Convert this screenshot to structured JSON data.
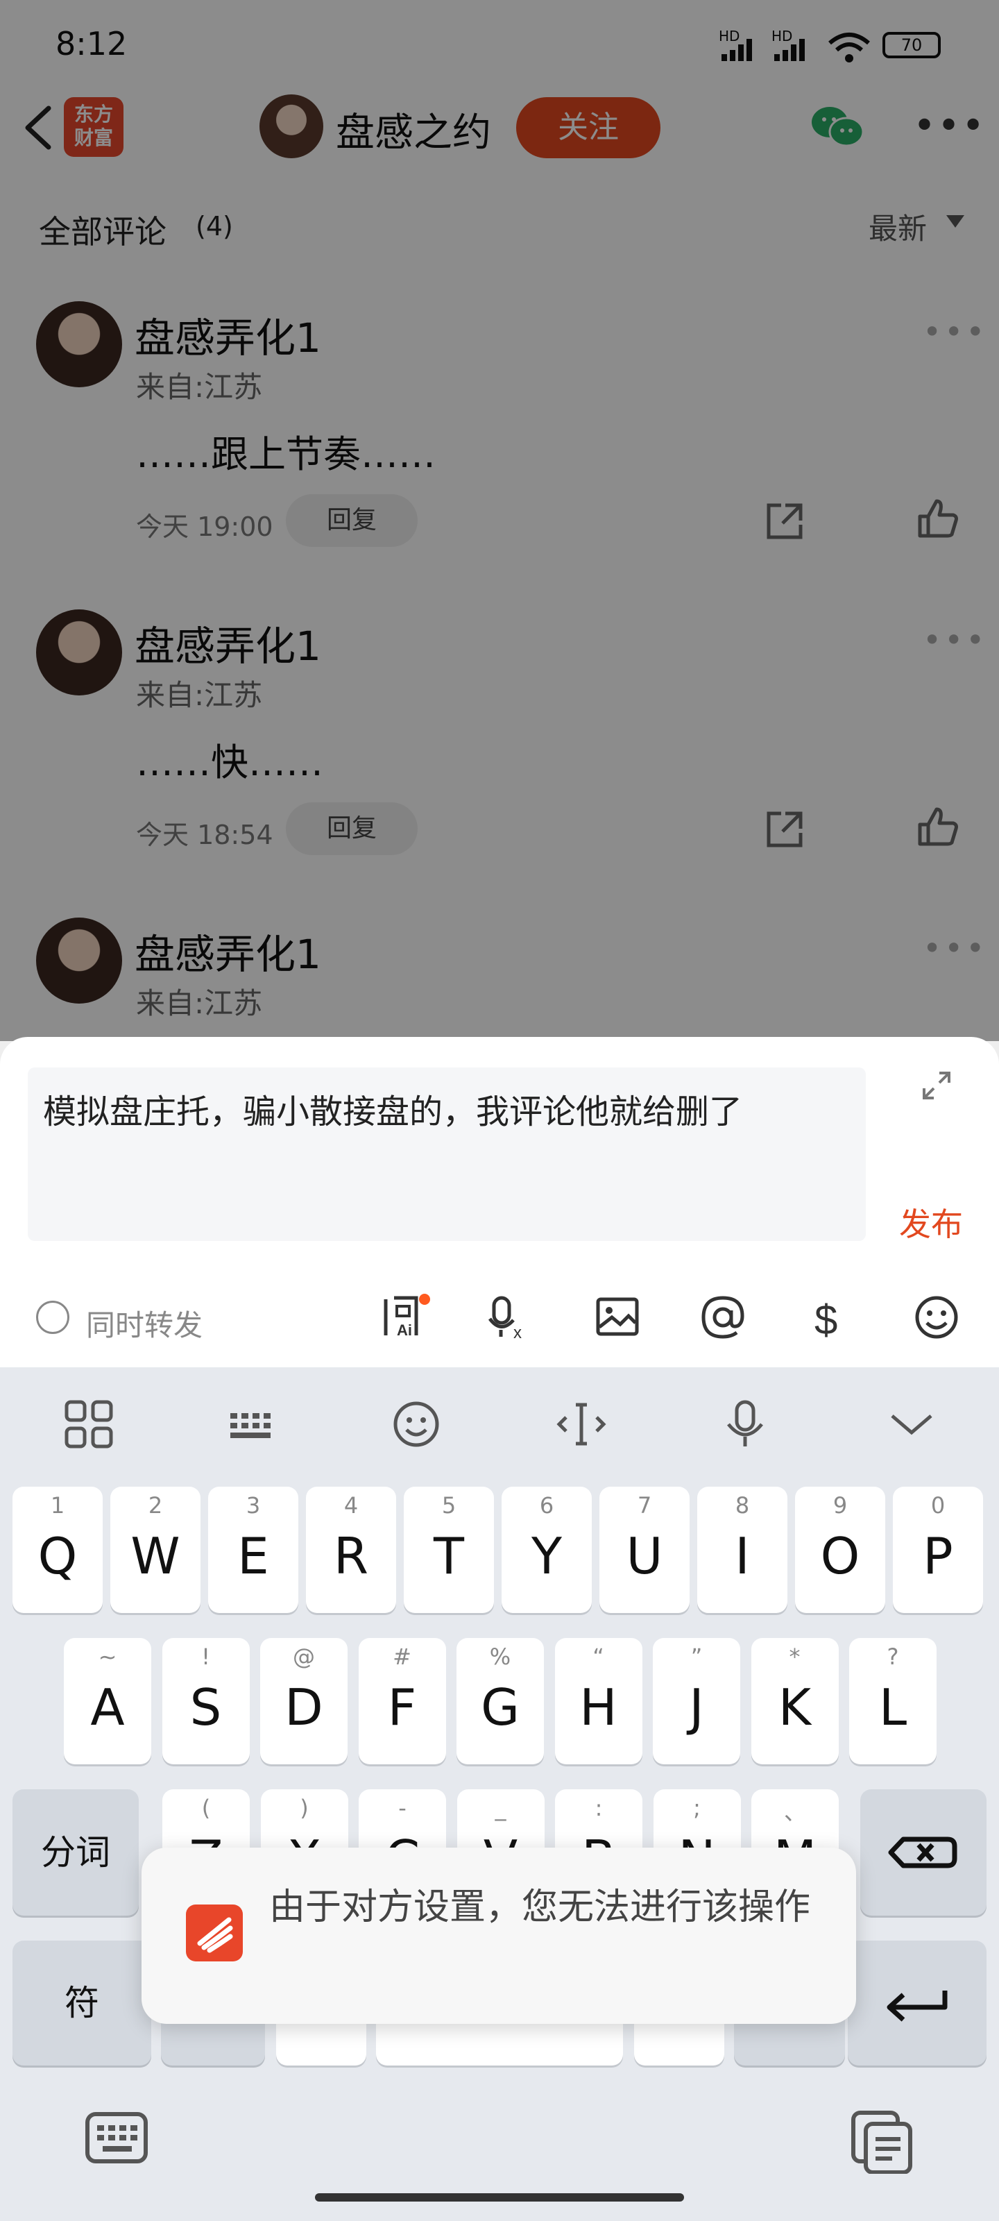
{
  "status_bar": {
    "time": "8:12",
    "signal1": "HD",
    "signal2": "HD",
    "battery": "70"
  },
  "header": {
    "logo_text": "东方\n财富",
    "author_name": "盘感之约",
    "follow_label": "关注"
  },
  "comments_section": {
    "title": "全部评论",
    "count": "(4)",
    "sort_label": "最新",
    "comments": [
      {
        "name": "盘感弄化1",
        "from": "来自:江苏",
        "text": "……跟上节奏……",
        "time": "今天 19:00",
        "reply_label": "回复"
      },
      {
        "name": "盘感弄化1",
        "from": "来自:江苏",
        "text": "……快……",
        "time": "今天 18:54",
        "reply_label": "回复"
      },
      {
        "name": "盘感弄化1",
        "from": "来自:江苏"
      }
    ]
  },
  "composer": {
    "input_value": "模拟盘庄托，骗小散接盘的，我评论他就给删了",
    "publish_label": "发布",
    "repost_label": "同时转发",
    "tools": [
      "ai-ask-icon",
      "voice-to-text-icon",
      "image-icon",
      "at-icon",
      "dollar-icon",
      "emoji-icon"
    ]
  },
  "keyboard": {
    "row1": [
      {
        "sub": "1",
        "main": "Q"
      },
      {
        "sub": "2",
        "main": "W"
      },
      {
        "sub": "3",
        "main": "E"
      },
      {
        "sub": "4",
        "main": "R"
      },
      {
        "sub": "5",
        "main": "T"
      },
      {
        "sub": "6",
        "main": "Y"
      },
      {
        "sub": "7",
        "main": "U"
      },
      {
        "sub": "8",
        "main": "I"
      },
      {
        "sub": "9",
        "main": "O"
      },
      {
        "sub": "0",
        "main": "P"
      }
    ],
    "row2": [
      {
        "sub": "~",
        "main": "A"
      },
      {
        "sub": "!",
        "main": "S"
      },
      {
        "sub": "@",
        "main": "D"
      },
      {
        "sub": "#",
        "main": "F"
      },
      {
        "sub": "%",
        "main": "G"
      },
      {
        "sub": "“",
        "main": "H"
      },
      {
        "sub": "”",
        "main": "J"
      },
      {
        "sub": "*",
        "main": "K"
      },
      {
        "sub": "?",
        "main": "L"
      }
    ],
    "row3": [
      {
        "sub": "(",
        "main": "Z"
      },
      {
        "sub": ")",
        "main": "X"
      },
      {
        "sub": "-",
        "main": "C"
      },
      {
        "sub": "_",
        "main": "V"
      },
      {
        "sub": ":",
        "main": "B"
      },
      {
        "sub": ";",
        "main": "N"
      },
      {
        "sub": "、",
        "main": "M"
      }
    ],
    "segment_label": "分词",
    "symbol_label": "符"
  },
  "toast": {
    "message": "由于对方设置，您无法进行该操作"
  },
  "colors": {
    "accent": "#e2481f",
    "keyboard_bg": "#e6e9ee"
  }
}
